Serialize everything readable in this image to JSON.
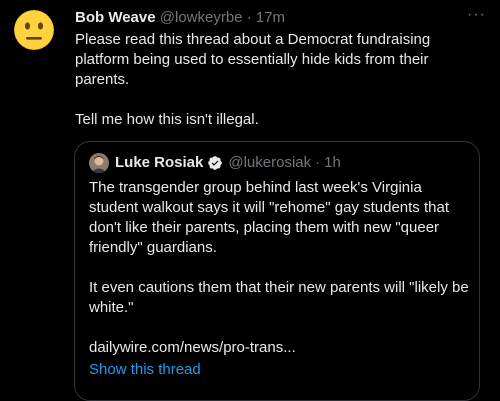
{
  "colors": {
    "background": "#000000",
    "text": "#e7e9ea",
    "muted": "#71767b",
    "accent": "#1d9bf0",
    "border": "#2f3336"
  },
  "tweet": {
    "author_name": "Bob Weave",
    "handle": "@lowkeyrbe",
    "separator": "·",
    "time": "17m",
    "more_icon": "more-horizontal-icon",
    "more_glyph": "···",
    "avatar_icon": "neutral-face-emoji",
    "text_paragraphs": [
      "Please read this thread about a Democrat fundraising platform being used to essentially hide kids from their parents.",
      "Tell me how this isn't illegal."
    ]
  },
  "quoted_tweet": {
    "author_name": "Luke Rosiak",
    "verified_icon": "verified-badge-icon",
    "handle": "@lukerosiak",
    "separator": "·",
    "time": "1h",
    "text_paragraphs": [
      "The transgender group behind last week's Virginia student walkout says it will \"rehome\" gay students that don't like their parents, placing them with new \"queer friendly\" guardians.",
      "It even cautions them that their new parents will \"likely be white.\"",
      "dailywire.com/news/pro-trans..."
    ],
    "show_thread_label": "Show this thread"
  }
}
